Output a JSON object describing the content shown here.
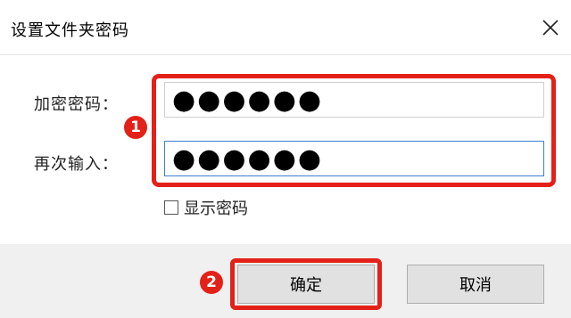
{
  "dialog": {
    "title": "设置文件夹密码",
    "close_icon": "close-icon"
  },
  "form": {
    "encrypt_label": "加密密码：",
    "encrypt_value": "●●●●●●",
    "confirm_label": "再次输入：",
    "confirm_value": "●●●●●●",
    "show_password_label": "显示密码",
    "show_password_checked": false
  },
  "annotations": {
    "step1": "1",
    "step2": "2",
    "highlight_color": "#e32119"
  },
  "buttons": {
    "ok_label": "确定",
    "cancel_label": "取消"
  }
}
